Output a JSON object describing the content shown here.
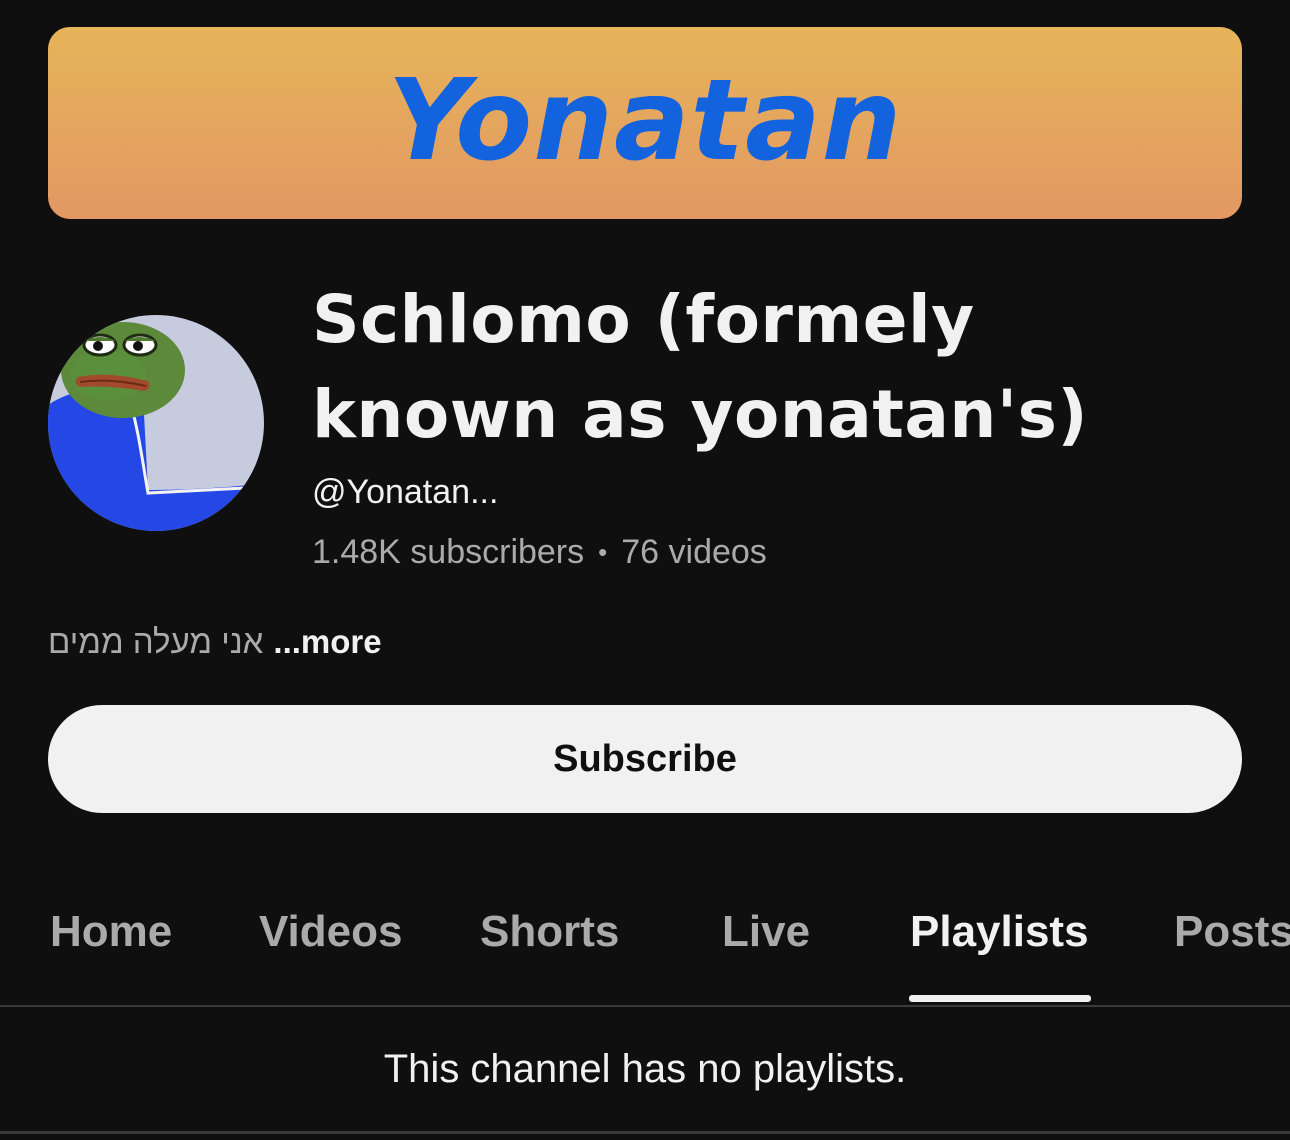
{
  "banner": {
    "text": "Yonatan",
    "text_color": "#1363df",
    "gradient_top": "#e6b459",
    "gradient_bottom": "#e39863"
  },
  "channel": {
    "name": "Schlomo (formely known as yonatan's)",
    "handle": "@Yonatan...",
    "subscribers": "1.48K subscribers",
    "separator": "•",
    "videos": "76 videos",
    "description": "אני מעלה ממים",
    "more_label": "...more",
    "avatar_icon": "pepe-frog-avatar"
  },
  "subscribe_button": {
    "label": "Subscribe"
  },
  "tabs": [
    {
      "label": "Home",
      "active": false
    },
    {
      "label": "Videos",
      "active": false
    },
    {
      "label": "Shorts",
      "active": false
    },
    {
      "label": "Live",
      "active": false
    },
    {
      "label": "Playlists",
      "active": true
    },
    {
      "label": "Posts",
      "active": false
    }
  ],
  "content": {
    "empty_message": "This channel has no playlists."
  },
  "colors": {
    "background": "#0f0f0f",
    "text_primary": "#f1f1f1",
    "text_secondary": "#aaaaaa"
  }
}
